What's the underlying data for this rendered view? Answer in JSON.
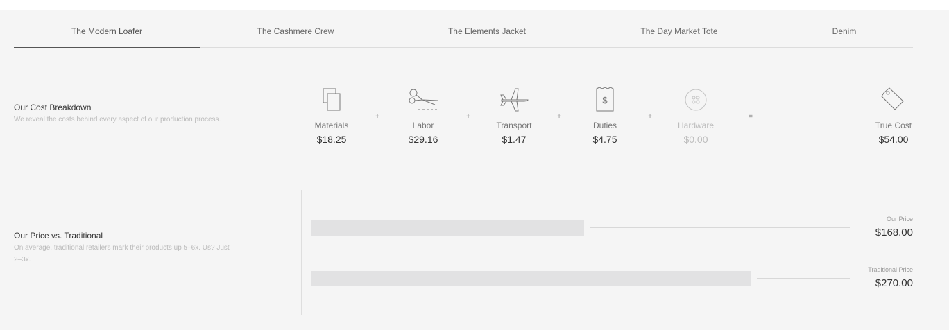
{
  "tabs": [
    {
      "label": "The Modern Loafer",
      "active": true
    },
    {
      "label": "The Cashmere Crew",
      "active": false
    },
    {
      "label": "The Elements Jacket",
      "active": false
    },
    {
      "label": "The Day Market Tote",
      "active": false
    },
    {
      "label": "Denim",
      "active": false
    }
  ],
  "cost_breakdown": {
    "title": "Our Cost Breakdown",
    "description": "We reveal the costs behind every aspect of our production process.",
    "items": [
      {
        "icon": "materials-icon",
        "label": "Materials",
        "value": "$18.25"
      },
      {
        "icon": "scissors-icon",
        "label": "Labor",
        "value": "$29.16"
      },
      {
        "icon": "airplane-icon",
        "label": "Transport",
        "value": "$1.47"
      },
      {
        "icon": "receipt-icon",
        "label": "Duties",
        "value": "$4.75"
      },
      {
        "icon": "button-icon",
        "label": "Hardware",
        "value": "$0.00"
      }
    ],
    "plus_sign": "+",
    "equals_sign": "=",
    "total": {
      "icon": "price-tag-icon",
      "label": "True Cost",
      "value": "$54.00"
    }
  },
  "price_comparison": {
    "title": "Our Price vs. Traditional",
    "description": "On average, traditional retailers mark their products up 5–6x. Us? Just 2–3x.",
    "our_price": {
      "label": "Our Price",
      "value": "$168.00",
      "amount": 168
    },
    "traditional_price": {
      "label": "Traditional Price",
      "value": "$270.00",
      "amount": 270
    }
  },
  "colors": {
    "bar": "#e2e2e3",
    "background": "#f5f5f5",
    "muted_text": "#bbbbbb"
  }
}
